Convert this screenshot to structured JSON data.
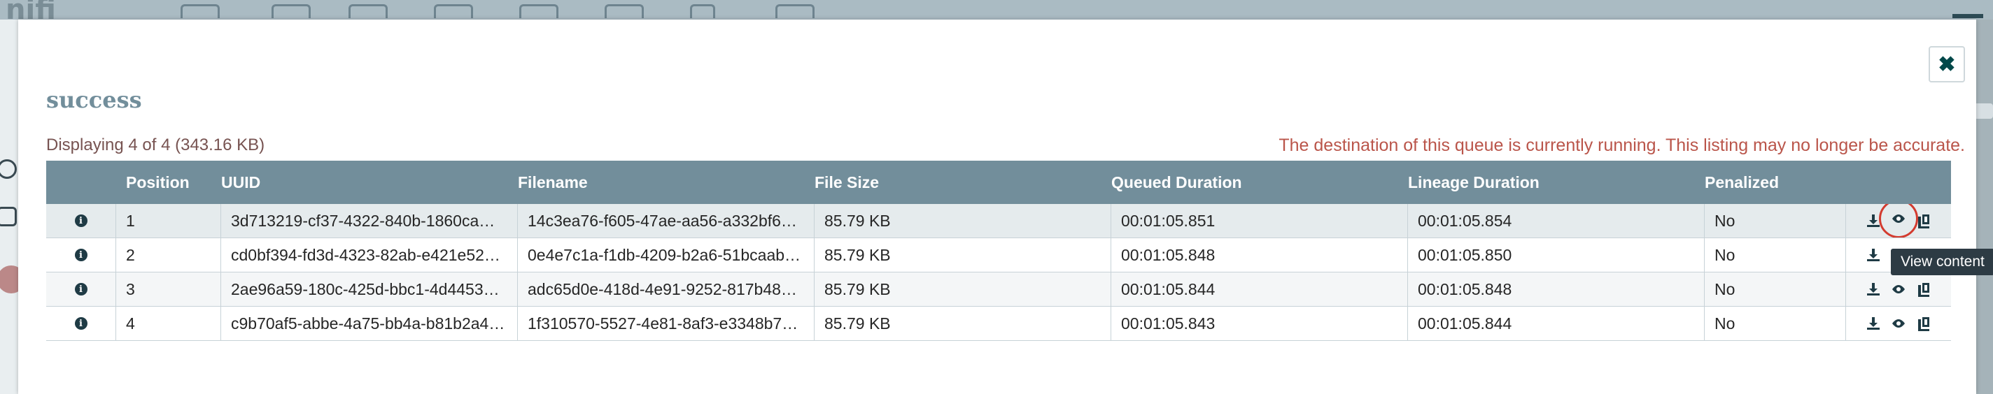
{
  "app": {
    "logo_text": "nifi"
  },
  "dialog": {
    "title": "success",
    "close_icon": "close-icon",
    "display_count": "Displaying 4 of 4 (343.16 KB)",
    "warning": "The destination of this queue is currently running. This listing may no longer be accurate."
  },
  "table": {
    "headers": {
      "position": "Position",
      "uuid": "UUID",
      "filename": "Filename",
      "file_size": "File Size",
      "queued_duration": "Queued Duration",
      "lineage_duration": "Lineage Duration",
      "penalized": "Penalized"
    },
    "rows": [
      {
        "position": "1",
        "uuid": "3d713219-cf37-4322-840b-1860ca…",
        "filename": "14c3ea76-f605-47ae-aa56-a332bf6…",
        "file_size": "85.79 KB",
        "queued_duration": "00:01:05.851",
        "lineage_duration": "00:01:05.854",
        "penalized": "No"
      },
      {
        "position": "2",
        "uuid": "cd0bf394-fd3d-4323-82ab-e421e52…",
        "filename": "0e4e7c1a-f1db-4209-b2a6-51bcaab…",
        "file_size": "85.79 KB",
        "queued_duration": "00:01:05.848",
        "lineage_duration": "00:01:05.850",
        "penalized": "No"
      },
      {
        "position": "3",
        "uuid": "2ae96a59-180c-425d-bbc1-4d4453…",
        "filename": "adc65d0e-418d-4e91-9252-817b48…",
        "file_size": "85.79 KB",
        "queued_duration": "00:01:05.844",
        "lineage_duration": "00:01:05.848",
        "penalized": "No"
      },
      {
        "position": "4",
        "uuid": "c9b70af5-abbe-4a75-bb4a-b81b2a4…",
        "filename": "1f310570-5527-4e81-8af3-e3348b7…",
        "file_size": "85.79 KB",
        "queued_duration": "00:01:05.843",
        "lineage_duration": "00:01:05.844",
        "penalized": "No"
      }
    ],
    "row_icons": [
      "info-icon",
      "download-icon",
      "eye-icon",
      "provenance-icon"
    ]
  },
  "tooltip": {
    "text": "View content"
  },
  "colors": {
    "header_bg": "#728e9b",
    "title": "#728e9b",
    "warning": "#ba554a",
    "count": "#775351",
    "highlight": "#d33b2f",
    "icon": "#1f3b45"
  }
}
